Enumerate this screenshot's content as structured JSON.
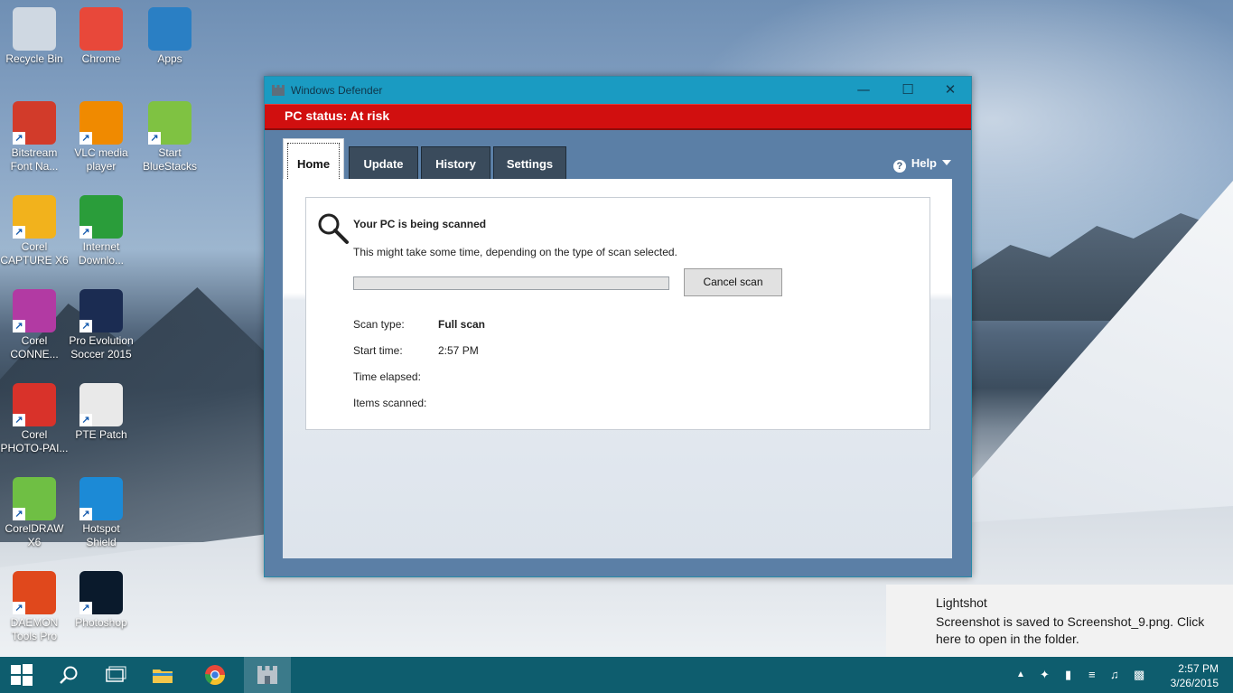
{
  "desktop": {
    "icons": [
      {
        "label": "Recycle Bin",
        "icon": "recycle-bin-icon",
        "color": "#cfd8e2"
      },
      {
        "label": "Chrome",
        "icon": "chrome-icon",
        "color": "#e8483a"
      },
      {
        "label": "Apps",
        "icon": "apps-folder-icon",
        "color": "#2a7fc4"
      },
      {
        "label": "Bitstream Font Na...",
        "icon": "bitstream-font-navigator-icon",
        "color": "#d23b2a"
      },
      {
        "label": "VLC media player",
        "icon": "vlc-icon",
        "color": "#f08a00"
      },
      {
        "label": "Start BlueStacks",
        "icon": "bluestacks-icon",
        "color": "#7fc242"
      },
      {
        "label": "Corel CAPTURE X6",
        "icon": "corel-capture-icon",
        "color": "#f2b21c"
      },
      {
        "label": "Internet Downlo...",
        "icon": "internet-download-manager-icon",
        "color": "#2a9d3a"
      },
      {
        "label": "Corel CONNE...",
        "icon": "corel-connect-icon",
        "color": "#b23aa3"
      },
      {
        "label": "Pro Evolution Soccer 2015",
        "icon": "pes-2015-icon",
        "color": "#1b2c52"
      },
      {
        "label": "Corel PHOTO-PAI...",
        "icon": "corel-photo-paint-icon",
        "color": "#d9322a"
      },
      {
        "label": "PTE Patch",
        "icon": "pte-patch-icon",
        "color": "#e9e9e9"
      },
      {
        "label": "CorelDRAW X6",
        "icon": "coreldraw-icon",
        "color": "#6fbf44"
      },
      {
        "label": "Hotspot Shield",
        "icon": "hotspot-shield-icon",
        "color": "#1c8ad6"
      },
      {
        "label": "DAEMON Tools Pro",
        "icon": "daemon-tools-icon",
        "color": "#e0481c"
      },
      {
        "label": "Photoshop",
        "icon": "photoshop-icon",
        "color": "#0a1a2c"
      }
    ]
  },
  "window": {
    "title": "Windows Defender",
    "status": "PC status: At risk",
    "status_color": "#d10f0f",
    "tabs": [
      {
        "label": "Home",
        "active": true
      },
      {
        "label": "Update",
        "active": false
      },
      {
        "label": "History",
        "active": false
      },
      {
        "label": "Settings",
        "active": false
      }
    ],
    "help_label": "Help",
    "scan": {
      "title": "Your PC is being scanned",
      "subtitle": "This might take some time, depending on the type of scan selected.",
      "progress": 0,
      "cancel_label": "Cancel scan",
      "details": [
        {
          "key": "Scan type:",
          "value": "Full scan",
          "bold": true
        },
        {
          "key": "Start time:",
          "value": "2:57 PM",
          "bold": false
        },
        {
          "key": "Time elapsed:",
          "value": "",
          "bold": false
        },
        {
          "key": "Items scanned:",
          "value": "",
          "bold": false
        }
      ]
    }
  },
  "toast": {
    "title": "Lightshot",
    "message": "Screenshot is saved to Screenshot_9.png. Click here to open in the folder."
  },
  "taskbar": {
    "time": "2:57 PM",
    "date": "3/26/2015",
    "accent": "#0e5d6e"
  }
}
